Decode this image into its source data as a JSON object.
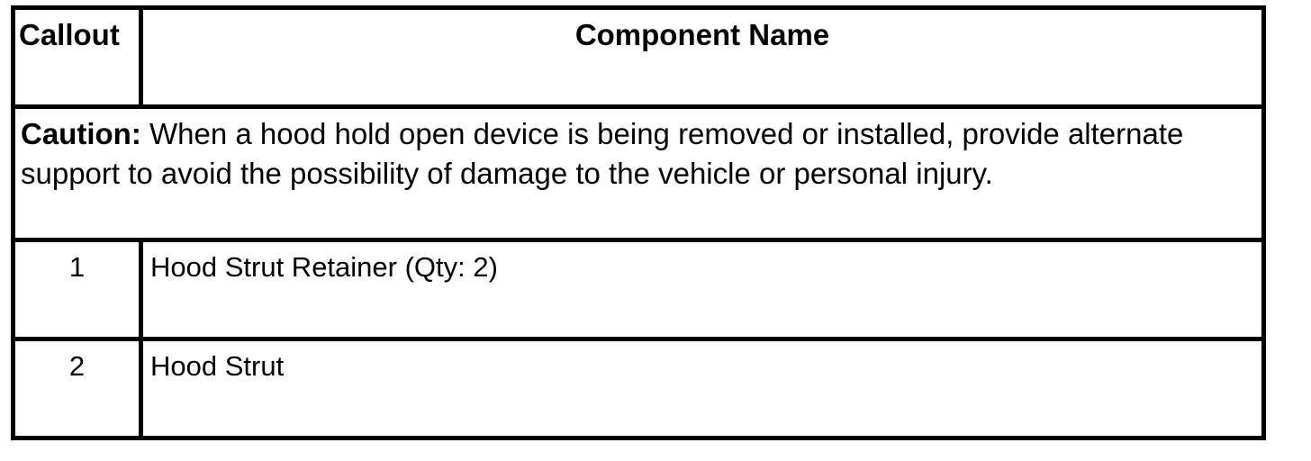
{
  "table": {
    "headers": {
      "callout": "Callout",
      "component_name": "Component Name"
    },
    "caution": {
      "label": "Caution:",
      "text": "When a hood hold open device is being removed or installed, provide alternate support to avoid the possibility of damage to the vehicle or personal injury."
    },
    "rows": [
      {
        "callout": "1",
        "component_name": "Hood Strut Retainer (Qty: 2)"
      },
      {
        "callout": "2",
        "component_name": "Hood Strut"
      }
    ]
  }
}
